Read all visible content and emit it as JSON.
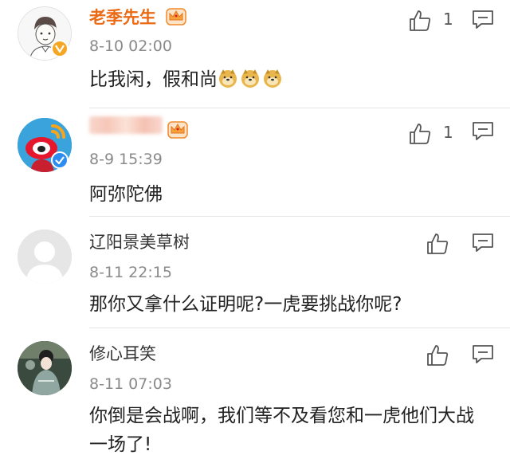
{
  "comments": [
    {
      "username": "老季先生",
      "timestamp": "8-10 02:00",
      "text": "比我闲，假和尚",
      "emojis": [
        "doge-icon",
        "doge-icon",
        "doge-icon"
      ],
      "like_count": "1",
      "vip": true,
      "verified": "gold"
    },
    {
      "username": "",
      "username_obscured": true,
      "timestamp": "8-9 15:39",
      "text": "阿弥陀佛",
      "like_count": "1",
      "vip": true,
      "verified": "blue"
    },
    {
      "username": "辽阳景美草树",
      "timestamp": "8-11 22:15",
      "text": "那你又拿什么证明呢?一虎要挑战你呢?",
      "like_count": "",
      "vip": false
    },
    {
      "username": "修心耳笑",
      "timestamp": "8-11 07:03",
      "text": "你倒是会战啊，我们等不及看您和一虎他们大战一场了!",
      "like_count": "",
      "vip": false
    }
  ],
  "colors": {
    "vip_name": "#eb6a16",
    "timestamp": "#8a8a8a",
    "divider": "#e6e6e6"
  }
}
